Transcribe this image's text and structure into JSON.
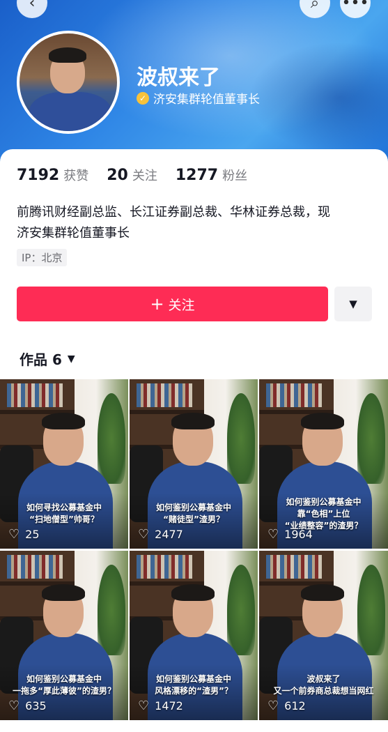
{
  "header": {
    "back_icon": "arrow-left-icon",
    "search_icon": "search-icon",
    "more_icon": "more-dots-icon",
    "gradient_colors": [
      "#1a5fc9",
      "#4aa6ef"
    ]
  },
  "profile": {
    "name": "波叔来了",
    "verification": "济安集群轮值董事长",
    "verify_icon": "verified-badge-icon",
    "verify_color": "#f7c23b"
  },
  "stats": [
    {
      "value": "7192",
      "label": "获赞"
    },
    {
      "value": "20",
      "label": "关注"
    },
    {
      "value": "1277",
      "label": "粉丝"
    }
  ],
  "bio": {
    "line1": "前腾讯财经副总监、长江证券副总裁、华林证券总裁，现",
    "line2": "济安集群轮值董事长"
  },
  "ip_tag": "IP：北京",
  "actions": {
    "follow_label": "关注",
    "follow_icon": "plus-icon",
    "follow_color": "#fe2c55",
    "dropdown_icon": "caret-down-icon"
  },
  "works": {
    "tab_label": "作品 6",
    "videos": [
      {
        "caption_line1": "如何寻找公募基金中",
        "caption_line2": "“扫地僧型”帅哥？",
        "caption_line3": "",
        "likes": "25"
      },
      {
        "caption_line1": "如何鉴别公募基金中",
        "caption_line2": "“赌徒型”渣男？",
        "caption_line3": "",
        "likes": "2477"
      },
      {
        "caption_line1": "如何鉴别公募基金中",
        "caption_line2": "靠“色相”上位",
        "caption_line3": "“业绩整容”的渣男？",
        "likes": "1964"
      },
      {
        "caption_line1": "如何鉴别公募基金中",
        "caption_line2": "一拖多“厚此薄彼”的渣男？",
        "caption_line3": "",
        "likes": "635"
      },
      {
        "caption_line1": "如何鉴别公募基金中",
        "caption_line2": "风格漂移的“渣男”？",
        "caption_line3": "",
        "likes": "1472"
      },
      {
        "caption_line1": "波叔来了",
        "caption_line2": "又一个前券商总裁想当网红",
        "caption_line3": "",
        "likes": "612"
      }
    ]
  }
}
